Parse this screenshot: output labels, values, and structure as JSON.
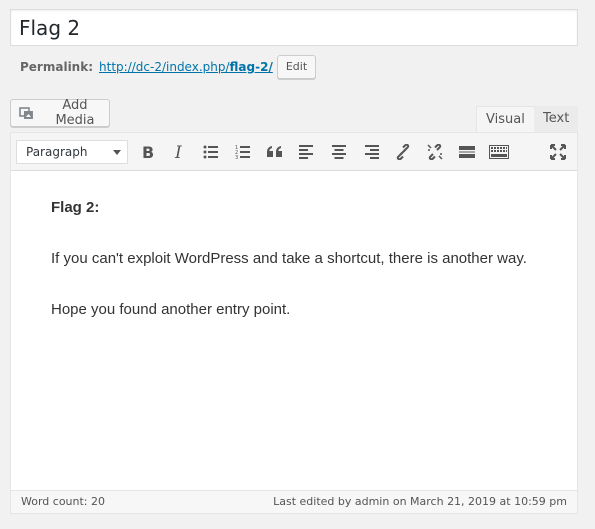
{
  "post": {
    "title": "Flag 2"
  },
  "permalink": {
    "label": "Permalink:",
    "url_base": "http://dc-2/index.php/",
    "url_slug": "flag-2/",
    "edit_label": "Edit"
  },
  "media": {
    "add_label": "Add Media"
  },
  "tabs": {
    "visual": "Visual",
    "text": "Text"
  },
  "toolbar": {
    "format_selected": "Paragraph",
    "buttons": [
      "bold-icon",
      "italic-icon",
      "bullet-list-icon",
      "numbered-list-icon",
      "blockquote-icon",
      "align-left-icon",
      "align-center-icon",
      "align-right-icon",
      "link-icon",
      "unlink-icon",
      "read-more-icon",
      "toolbar-toggle-icon",
      "fullscreen-icon"
    ]
  },
  "content": {
    "heading": "Flag 2:",
    "para1": "If you can't exploit WordPress and take a shortcut, there is another way.",
    "para2": "Hope you found another entry point."
  },
  "status": {
    "word_count": "Word count: 20",
    "last_edited": "Last edited by admin on March 21, 2019 at 10:59 pm"
  },
  "colors": {
    "link": "#0073aa",
    "background": "#f1f1f1"
  }
}
